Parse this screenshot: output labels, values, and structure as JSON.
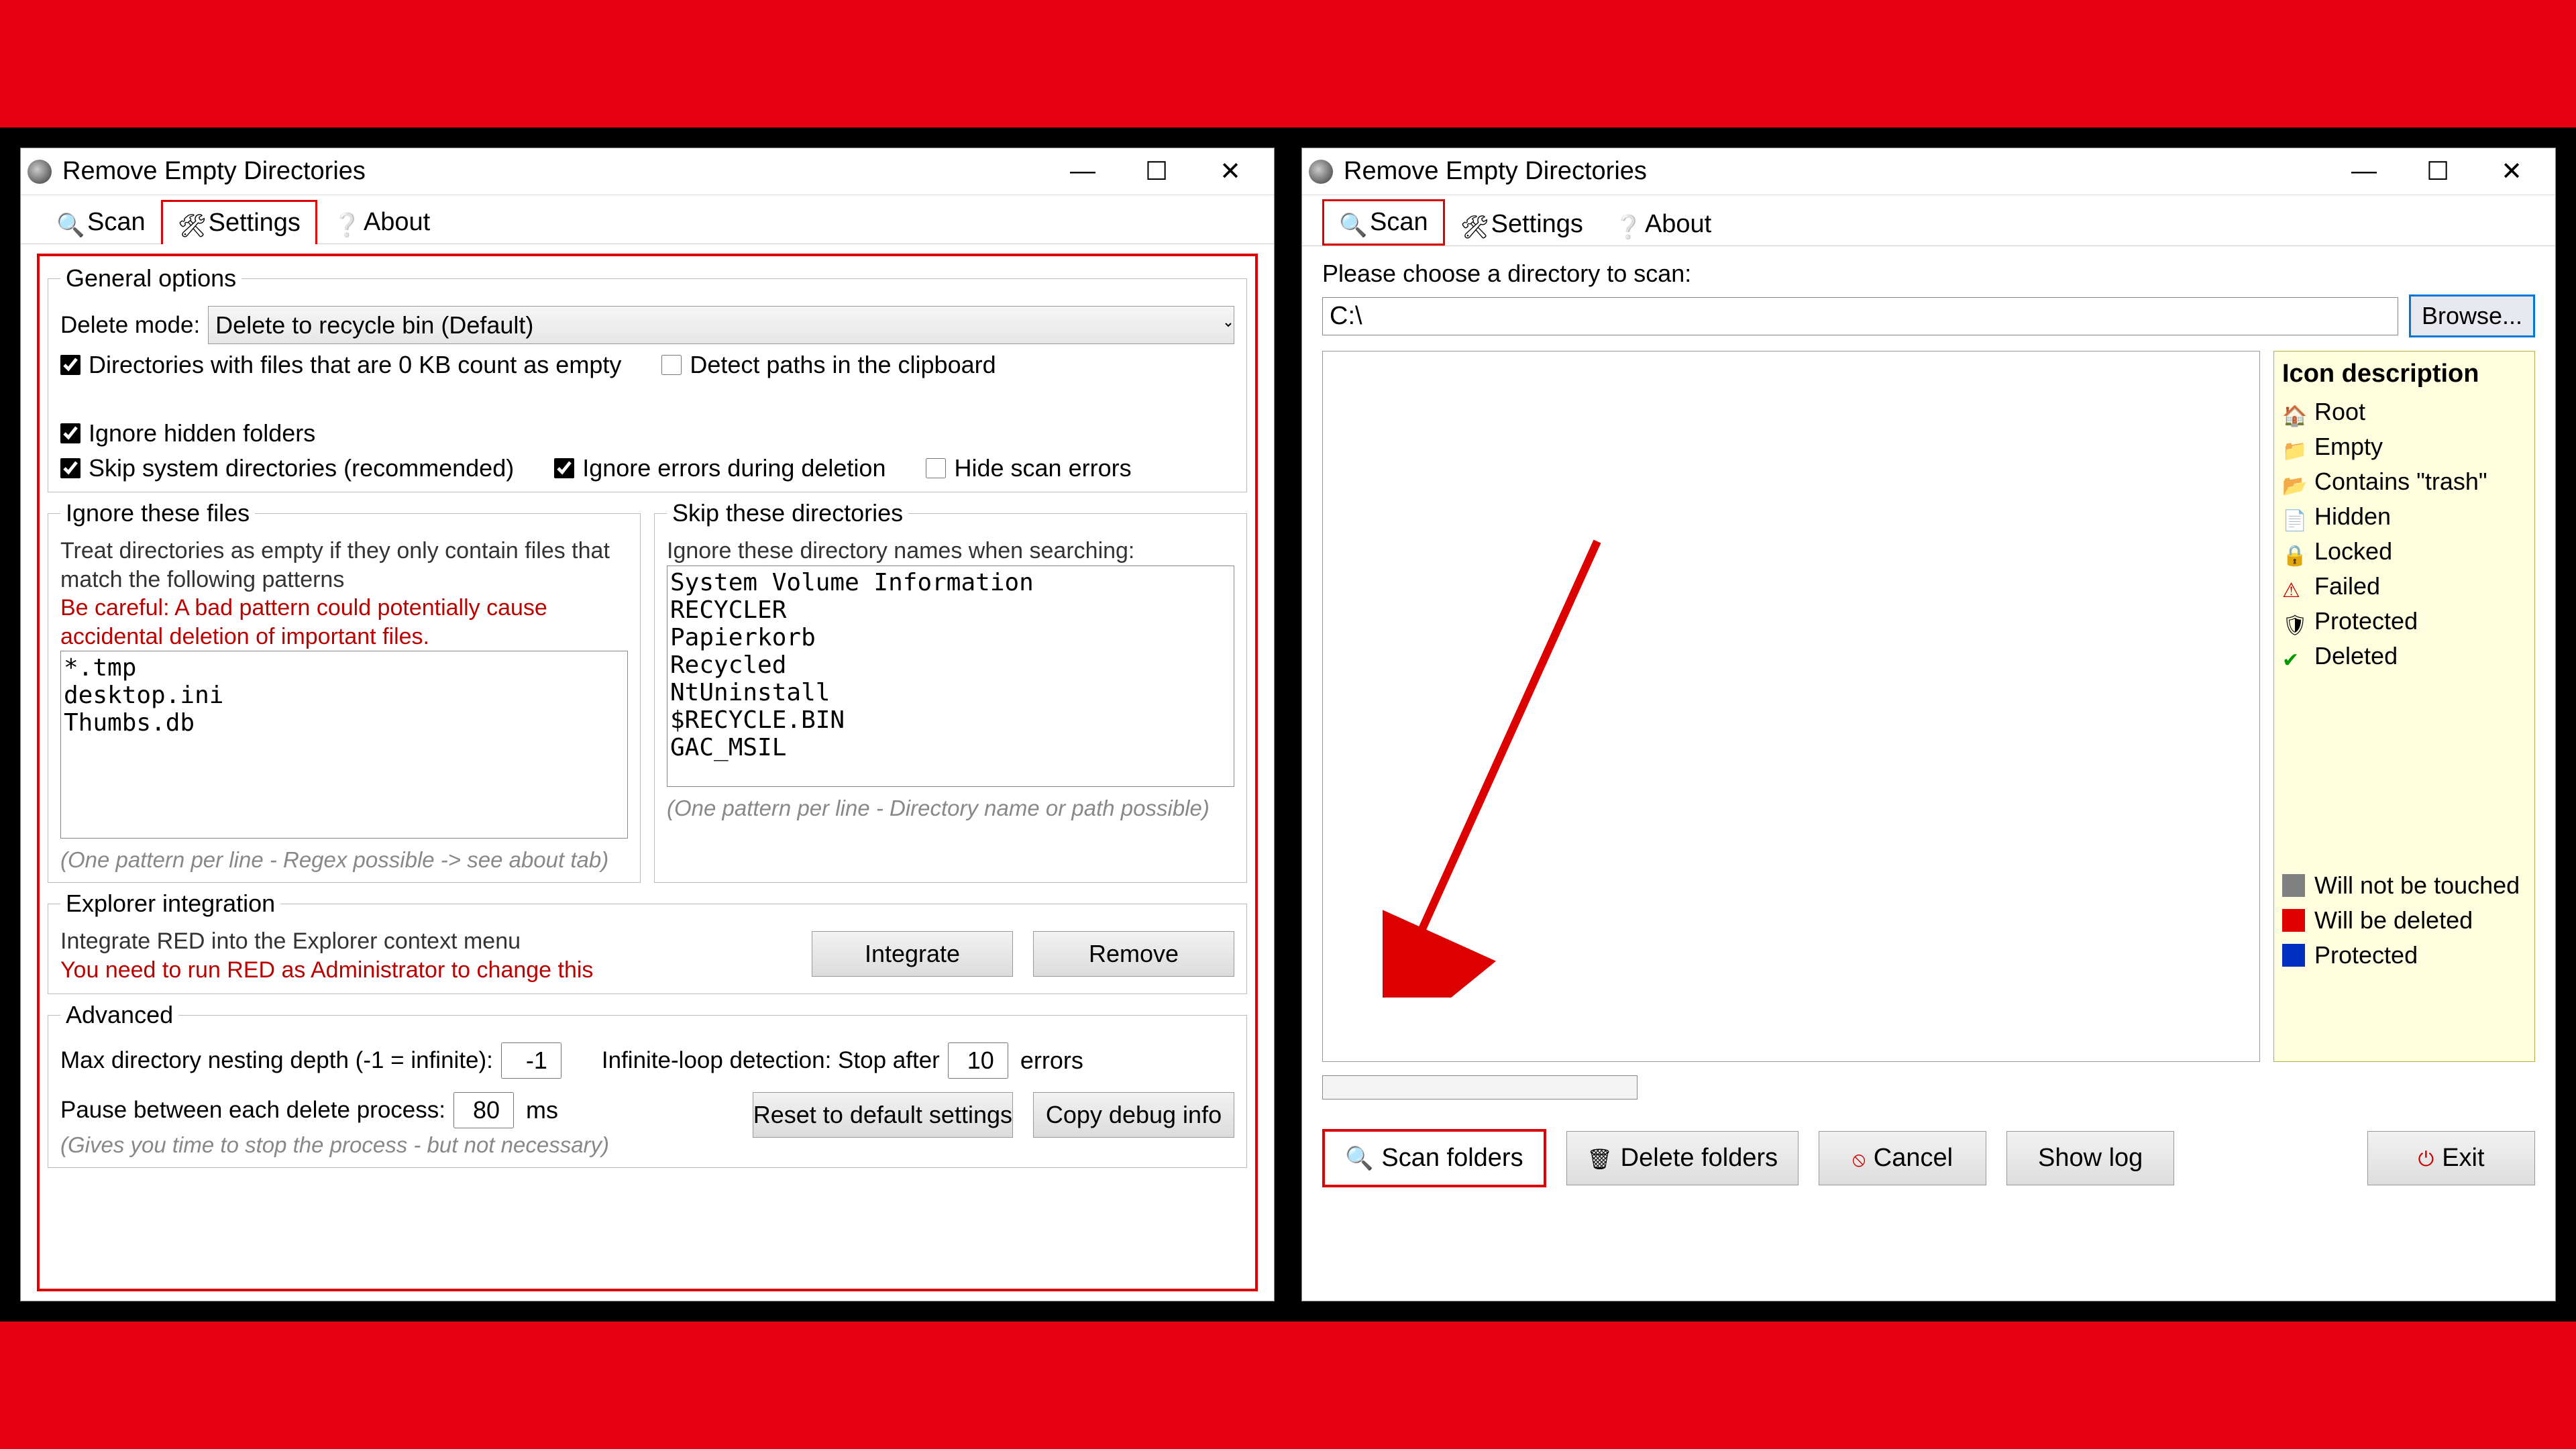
{
  "window_title": "Remove Empty Directories",
  "tabs": {
    "scan": "Scan",
    "settings": "Settings",
    "about": "About"
  },
  "settings": {
    "group_general": "General options",
    "delete_mode_label": "Delete mode:",
    "delete_mode_value": "Delete to recycle bin (Default)",
    "chk_0kb": "Directories with files that are 0 KB count as empty",
    "chk_clipboard": "Detect paths in the clipboard",
    "chk_hidden": "Ignore hidden folders",
    "chk_skip_sys": "Skip system directories (recommended)",
    "chk_ignore_err": "Ignore errors during deletion",
    "chk_hide_err": "Hide scan errors",
    "group_ignore_files": "Ignore these files",
    "ignore_files_desc": "Treat directories as empty if they only contain files that match the following patterns",
    "ignore_files_warn": "Be careful: A bad pattern could potentially cause accidental deletion of important files.",
    "ignore_files_list": "*.tmp\ndesktop.ini\nThumbs.db",
    "ignore_files_hint": "(One pattern per line - Regex possible -> see about tab)",
    "group_skip_dirs": "Skip these directories",
    "skip_dirs_desc": "Ignore these directory names when searching:",
    "skip_dirs_list": "System Volume Information\nRECYCLER\nPapierkorb\nRecycled\nNtUninstall\n$RECYCLE.BIN\nGAC_MSIL",
    "skip_dirs_hint": "(One pattern per line - Directory name or path possible)",
    "group_explorer": "Explorer integration",
    "explorer_desc": "Integrate RED into the Explorer context menu",
    "explorer_warn": "You need to run RED as Administrator to change this",
    "integrate_btn": "Integrate",
    "remove_btn": "Remove",
    "group_advanced": "Advanced",
    "adv_depth_label": "Max directory nesting depth (-1 = infinite):",
    "adv_depth_val": "-1",
    "adv_pause_label": "Pause between each delete process:",
    "adv_pause_val": "80",
    "adv_pause_unit": "ms",
    "adv_pause_hint": "(Gives you time to stop the process - but not necessary)",
    "adv_loop_label": "Infinite-loop detection: Stop after",
    "adv_loop_val": "10",
    "adv_loop_unit": "errors",
    "reset_btn": "Reset to default settings",
    "copy_btn": "Copy debug info"
  },
  "scan": {
    "prompt": "Please choose a directory to scan:",
    "path": "C:\\",
    "browse": "Browse...",
    "legend_title": "Icon description",
    "legend_items": [
      {
        "icon": "i-home",
        "label": "Root"
      },
      {
        "icon": "i-folder",
        "label": "Empty"
      },
      {
        "icon": "i-folderb",
        "label": "Contains \"trash\""
      },
      {
        "icon": "i-hidden",
        "label": "Hidden"
      },
      {
        "icon": "i-lock",
        "label": "Locked"
      },
      {
        "icon": "i-warn",
        "label": "Failed"
      },
      {
        "icon": "i-shield",
        "label": "Protected"
      },
      {
        "icon": "i-check",
        "label": "Deleted"
      }
    ],
    "legend_status": [
      {
        "color": "#808080",
        "label": "Will not be touched"
      },
      {
        "color": "#e00000",
        "label": "Will be deleted"
      },
      {
        "color": "#0030c0",
        "label": "Protected"
      }
    ],
    "btn_scan": "Scan folders",
    "btn_delete": "Delete folders",
    "btn_cancel": "Cancel",
    "btn_showlog": "Show log",
    "btn_exit": "Exit"
  }
}
